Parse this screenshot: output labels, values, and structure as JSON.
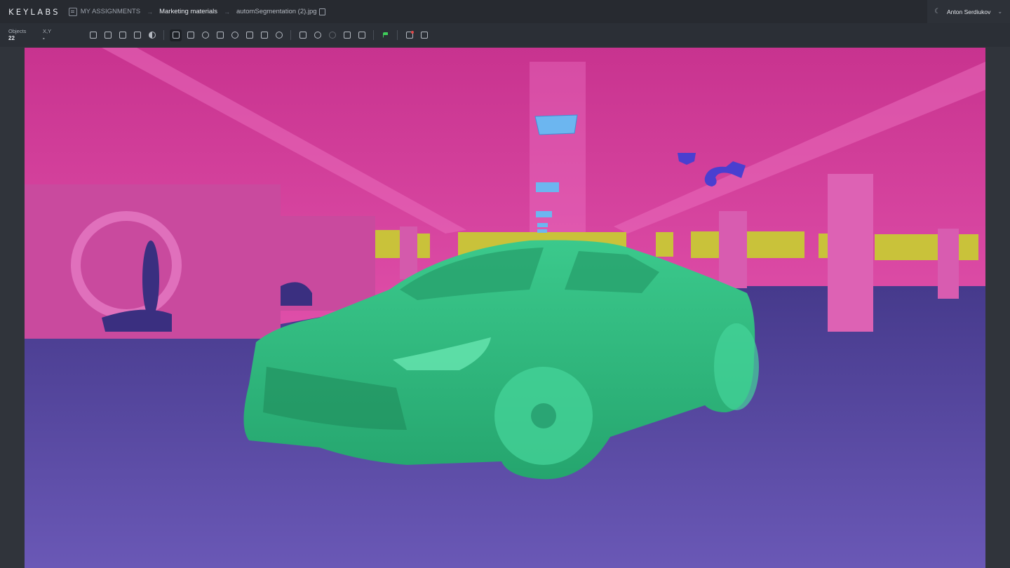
{
  "app": {
    "logo": "KEYLABS"
  },
  "breadcrumb": {
    "assignments": "MY ASSIGNMENTS",
    "project": "Marketing materials",
    "file": "automSegmentation (2).jpg"
  },
  "user": {
    "name": "Anton Serdiukov"
  },
  "stats": {
    "objects_label": "Objects",
    "objects_value": "22",
    "xy_label": "X,Y",
    "xy_value": "-"
  },
  "toolbar_icons": [
    "copy-object-icon",
    "comment-icon",
    "list-icon",
    "lock-icon",
    "contrast-icon",
    "layers-icon",
    "keypoints-icon",
    "polygon-icon",
    "segment-icon",
    "brush-icon",
    "cuboid-icon",
    "box-icon",
    "history-icon",
    "select-icon",
    "undo-icon",
    "redo-icon",
    "tag-icon",
    "ruler-icon",
    "flag-icon",
    "notification-icon",
    "export-icon"
  ],
  "segmentation_classes": {
    "structure": "#d43f9c",
    "floor": "#5a48a8",
    "car": "#2fb97e",
    "light": "#6cb6f0",
    "window": "#c9c23a",
    "camera": "#4a3fd0"
  }
}
